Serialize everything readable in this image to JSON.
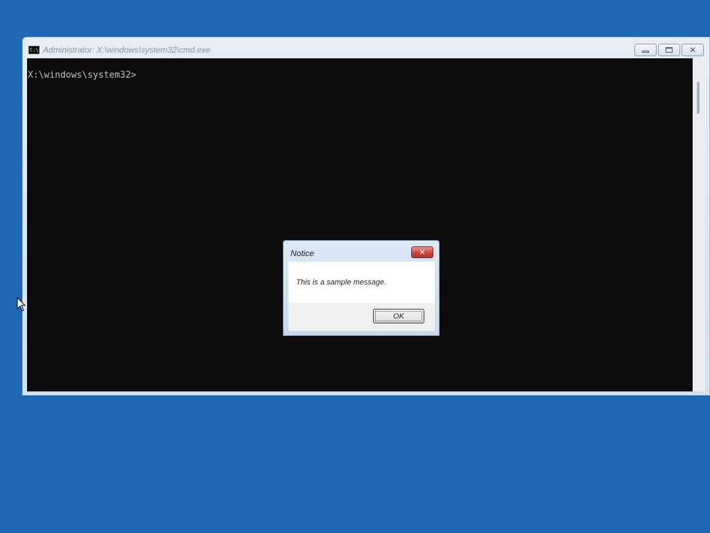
{
  "desktop": {
    "background_color": "#1f67b2"
  },
  "cmd_window": {
    "title": "Administrator: X:\\windows\\system32\\cmd.exe",
    "icon_text": "C:\\",
    "prompt": "X:\\windows\\system32>",
    "caption_buttons": {
      "minimize": "minimize-icon",
      "maximize": "maximize-icon",
      "close": "close-icon"
    }
  },
  "message_box": {
    "title": "Notice",
    "message": "This is a sample message.",
    "close_glyph": "✕",
    "ok_label": "OK"
  },
  "cursor": {
    "icon": "arrow-cursor-icon"
  }
}
